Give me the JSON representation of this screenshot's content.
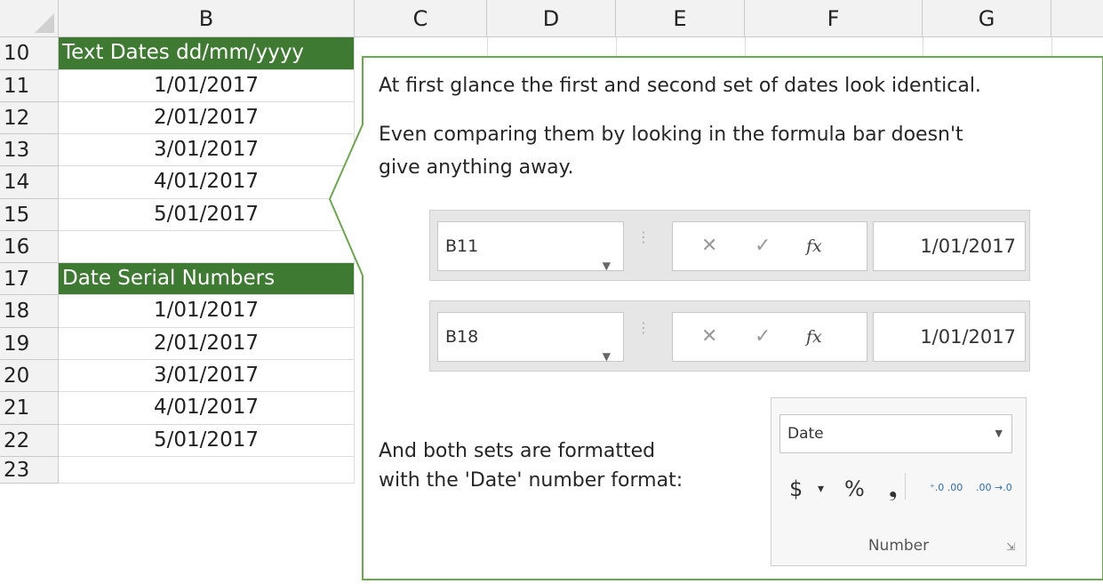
{
  "columns": [
    "B",
    "C",
    "D",
    "E",
    "F",
    "G"
  ],
  "rows": [
    "10",
    "11",
    "12",
    "13",
    "14",
    "15",
    "16",
    "17",
    "18",
    "19",
    "20",
    "21",
    "22",
    "23"
  ],
  "column_b": {
    "header_text_dates": "Text Dates dd/mm/yyyy",
    "text_dates": [
      "1/01/2017",
      "2/01/2017",
      "3/01/2017",
      "4/01/2017",
      "5/01/2017"
    ],
    "header_serial": "Date Serial Numbers",
    "serial_dates": [
      "1/01/2017",
      "2/01/2017",
      "3/01/2017",
      "4/01/2017",
      "5/01/2017"
    ]
  },
  "callout": {
    "line1": "At first glance the first and second set of dates look identical.",
    "line2": "Even comparing them by looking in the formula bar doesn't",
    "line3": "give anything away.",
    "line4": "And both sets are formatted",
    "line5": "with the 'Date' number format:",
    "border_color": "#5a9e4a"
  },
  "formula_bars": [
    {
      "name_box": "B11",
      "value": "1/01/2017"
    },
    {
      "name_box": "B18",
      "value": "1/01/2017"
    }
  ],
  "formula_icons": {
    "cancel": "✕",
    "enter": "✓",
    "fx": "fx",
    "dropdown": "▼",
    "dots": "⋮"
  },
  "number_group": {
    "format_value": "Date",
    "currency": "$",
    "currency_dd": "▾",
    "percent": "%",
    "comma": "❟",
    "inc_decimal": "⁺.0 .00",
    "dec_decimal": ".00 →.0",
    "label": "Number",
    "launcher": "⇲"
  },
  "colors": {
    "header_green": "#3f7a32",
    "header_text": "#ffffff"
  }
}
